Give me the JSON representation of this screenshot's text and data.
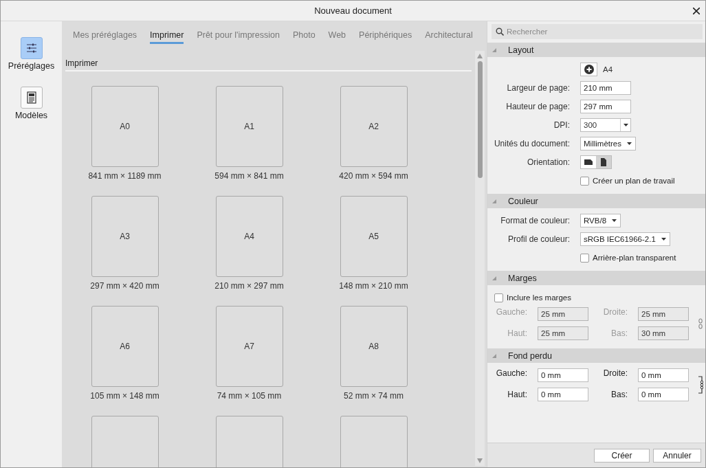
{
  "window": {
    "title": "Nouveau document"
  },
  "sidebar": {
    "items": [
      {
        "label": "Préréglages",
        "selected": true
      },
      {
        "label": "Modèles",
        "selected": false
      }
    ]
  },
  "tabs": [
    {
      "label": "Mes préréglages",
      "selected": false
    },
    {
      "label": "Imprimer",
      "selected": true
    },
    {
      "label": "Prêt pour l'impression",
      "selected": false
    },
    {
      "label": "Photo",
      "selected": false
    },
    {
      "label": "Web",
      "selected": false
    },
    {
      "label": "Périphériques",
      "selected": false
    },
    {
      "label": "Architectural",
      "selected": false
    }
  ],
  "gallery": {
    "heading": "Imprimer",
    "presets": [
      {
        "kind": "page",
        "name": "A0",
        "size": "841 mm × 1189 mm"
      },
      {
        "kind": "page",
        "name": "A1",
        "size": "594 mm × 841 mm"
      },
      {
        "kind": "page",
        "name": "A2",
        "size": "420 mm × 594 mm"
      },
      {
        "kind": "page",
        "name": "A3",
        "size": "297 mm × 420 mm"
      },
      {
        "kind": "page",
        "name": "A4",
        "size": "210 mm × 297 mm"
      },
      {
        "kind": "page",
        "name": "A5",
        "size": "148 mm × 210 mm"
      },
      {
        "kind": "page",
        "name": "A6",
        "size": "105 mm × 148 mm"
      },
      {
        "kind": "page",
        "name": "A7",
        "size": "74 mm × 105 mm"
      },
      {
        "kind": "page",
        "name": "A8",
        "size": "52 mm × 74 mm"
      },
      {
        "kind": "cut"
      },
      {
        "kind": "cut"
      },
      {
        "kind": "cut"
      }
    ]
  },
  "search": {
    "placeholder": "Rechercher"
  },
  "sections": [
    {
      "title": "Layout",
      "expanded": true,
      "rows": [
        {
          "kind": "preset",
          "value": "A4"
        },
        {
          "kind": "field",
          "label": "Largeur de page:",
          "value": "210 mm"
        },
        {
          "kind": "field",
          "label": "Hauteur de page:",
          "value": "297 mm"
        },
        {
          "kind": "combo",
          "label": "DPI:",
          "value": "300"
        },
        {
          "kind": "dropdown",
          "label": "Unités du document:",
          "value": "Millimètres"
        },
        {
          "kind": "orientation",
          "label": "Orientation:",
          "options": [
            {
              "selected": false
            },
            {
              "selected": true
            }
          ]
        },
        {
          "kind": "checkbox",
          "label": "Créer un plan de travail",
          "checked": false
        }
      ]
    },
    {
      "title": "Couleur",
      "expanded": true,
      "rows": [
        {
          "kind": "dropdown",
          "label": "Format de couleur:",
          "value": "RVB/8"
        },
        {
          "kind": "dropdown",
          "label": "Profil de couleur:",
          "value": "sRGB IEC61966-2.1"
        },
        {
          "kind": "checkbox",
          "label": "Arrière-plan transparent",
          "checked": false
        }
      ]
    },
    {
      "title": "Marges",
      "expanded": true,
      "rows": [
        {
          "kind": "checkbox_left",
          "label": "Inclure les marges",
          "checked": false
        },
        {
          "kind": "pairs",
          "disabled": true,
          "linked": false,
          "fields": [
            {
              "label": "Gauche:",
              "value": "25 mm"
            },
            {
              "label": "Droite:",
              "value": "25 mm"
            },
            {
              "label": "Haut:",
              "value": "25 mm"
            },
            {
              "label": "Bas:",
              "value": "30 mm"
            }
          ]
        }
      ]
    },
    {
      "title": "Fond perdu",
      "expanded": true,
      "rows": [
        {
          "kind": "pairs",
          "disabled": false,
          "linked": true,
          "fields": [
            {
              "label": "Gauche:",
              "value": "0 mm"
            },
            {
              "label": "Droite:",
              "value": "0 mm"
            },
            {
              "label": "Haut:",
              "value": "0 mm"
            },
            {
              "label": "Bas:",
              "value": "0 mm"
            }
          ]
        }
      ]
    }
  ],
  "buttons": [
    {
      "label": "Créer"
    },
    {
      "label": "Annuler"
    }
  ]
}
